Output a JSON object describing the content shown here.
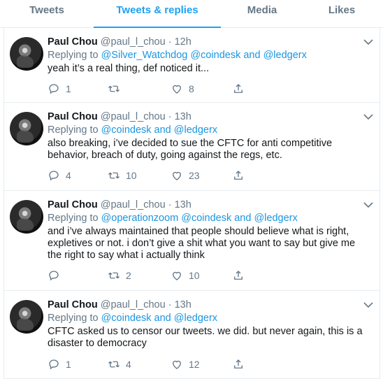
{
  "tabs": [
    "Tweets",
    "Tweets & replies",
    "Media",
    "Likes"
  ],
  "active_tab": 1,
  "tweets": [
    {
      "name": "Paul Chou",
      "handle": "@paul_l_chou",
      "dot": "·",
      "time": "12h",
      "replying_prefix": "Replying to",
      "mentions": "@Silver_Watchdog @coindesk and @ledgerx",
      "text": "yeah it’s a real thing, def noticed it...",
      "replies": "1",
      "retweets": "",
      "likes": "8"
    },
    {
      "name": "Paul Chou",
      "handle": "@paul_l_chou",
      "dot": "·",
      "time": "13h",
      "replying_prefix": "Replying to",
      "mentions": "@coindesk and @ledgerx",
      "text": "also breaking, i’ve decided to sue the CFTC for anti competitive behavior, breach of duty, going against the regs, etc.",
      "replies": "4",
      "retweets": "10",
      "likes": "23"
    },
    {
      "name": "Paul Chou",
      "handle": "@paul_l_chou",
      "dot": "·",
      "time": "13h",
      "replying_prefix": "Replying to",
      "mentions": "@operationzoom @coindesk and @ledgerx",
      "text": "and i’ve always maintained that people should believe what is right, expletives or not. i don’t give a shit what you want to say but give me the right to say what i actually think",
      "replies": "",
      "retweets": "2",
      "likes": "10"
    },
    {
      "name": "Paul Chou",
      "handle": "@paul_l_chou",
      "dot": "·",
      "time": "13h",
      "replying_prefix": "Replying to",
      "mentions": "@coindesk and @ledgerx",
      "text": "CFTC asked us to censor our tweets. we did. but never again, this is a disaster to democracy",
      "replies": "1",
      "retweets": "4",
      "likes": "12"
    }
  ],
  "icons": {
    "reply": "reply-icon",
    "retweet": "retweet-icon",
    "like": "heart-icon",
    "share": "share-icon",
    "caret": "chevron-down-icon"
  },
  "colors": {
    "accent": "#1da1f2",
    "muted": "#657786",
    "link": "#1b95e0"
  }
}
